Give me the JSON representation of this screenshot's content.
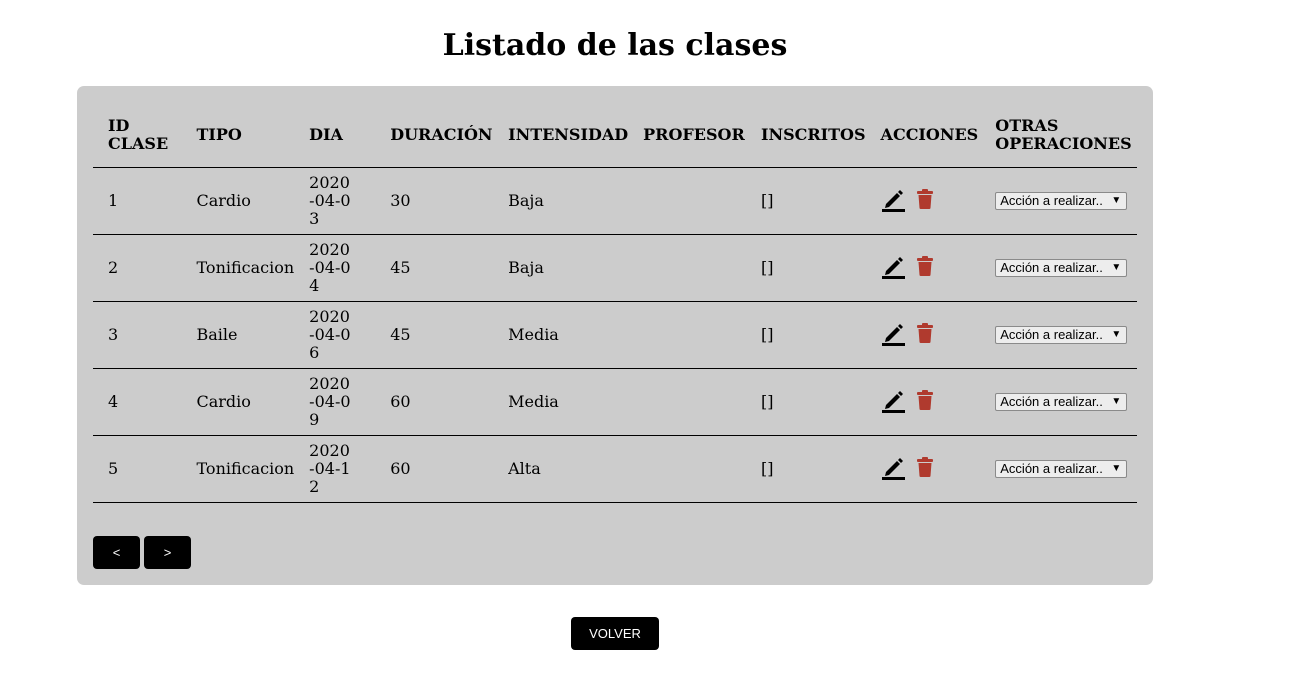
{
  "page": {
    "title": "Listado de las clases"
  },
  "table": {
    "headers": {
      "id": "ID CLASE",
      "tipo": "TIPO",
      "dia": "DIA",
      "duracion": "DURACIÓN",
      "intensidad": "INTENSIDAD",
      "profesor": "PROFESOR",
      "inscritos": "INSCRITOS",
      "acciones": "ACCIONES",
      "otras": "OTRAS OPERACIONES"
    },
    "rows": [
      {
        "id": "1",
        "tipo": "Cardio",
        "dia": "2020-04-03",
        "duracion": "30",
        "intensidad": "Baja",
        "profesor": "",
        "inscritos": "[]",
        "operacion": "Acción a realizar.."
      },
      {
        "id": "2",
        "tipo": "Tonificacion",
        "dia": "2020-04-04",
        "duracion": "45",
        "intensidad": "Baja",
        "profesor": "",
        "inscritos": "[]",
        "operacion": "Acción a realizar.."
      },
      {
        "id": "3",
        "tipo": "Baile",
        "dia": "2020-04-06",
        "duracion": "45",
        "intensidad": "Media",
        "profesor": "",
        "inscritos": "[]",
        "operacion": "Acción a realizar.."
      },
      {
        "id": "4",
        "tipo": "Cardio",
        "dia": "2020-04-09",
        "duracion": "60",
        "intensidad": "Media",
        "profesor": "",
        "inscritos": "[]",
        "operacion": "Acción a realizar.."
      },
      {
        "id": "5",
        "tipo": "Tonificacion",
        "dia": "2020-04-12",
        "duracion": "60",
        "intensidad": "Alta",
        "profesor": "",
        "inscritos": "[]",
        "operacion": "Acción a realizar.."
      }
    ],
    "icons": {
      "edit": "pencil-edit-icon",
      "delete": "trash-icon"
    },
    "colors": {
      "panel_bg": "#cccccc",
      "delete_icon": "#b03a2e",
      "edit_icon": "#000000"
    }
  },
  "pagination": {
    "prev_label": "<",
    "next_label": ">"
  },
  "footer": {
    "back_label": "VOLVER"
  }
}
